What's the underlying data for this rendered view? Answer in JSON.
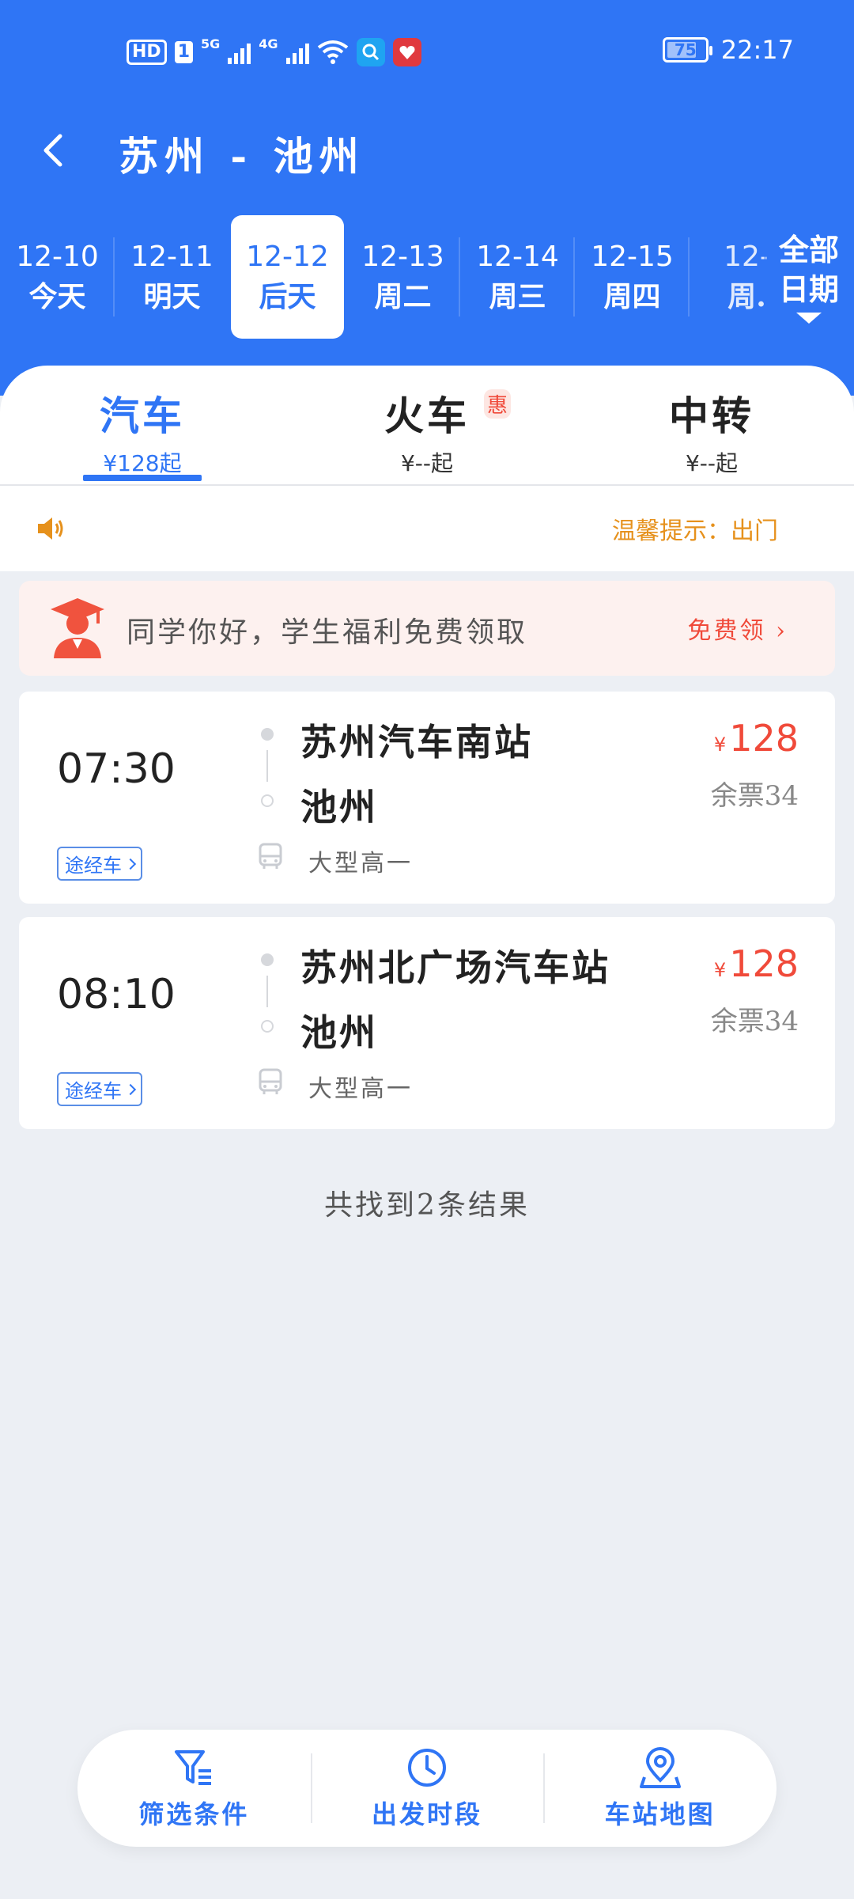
{
  "status_bar": {
    "hd": "HD",
    "sim": "1",
    "net1": "5G",
    "net2": "4G",
    "battery": "75",
    "time": "22:17"
  },
  "header": {
    "title": "苏州 - 池州"
  },
  "dates": [
    {
      "date": "12-10",
      "label": "今天"
    },
    {
      "date": "12-11",
      "label": "明天"
    },
    {
      "date": "12-12",
      "label": "后天"
    },
    {
      "date": "12-13",
      "label": "周二"
    },
    {
      "date": "12-14",
      "label": "周三"
    },
    {
      "date": "12-15",
      "label": "周四"
    },
    {
      "date": "12-",
      "label": "周."
    }
  ],
  "all_dates": {
    "line1": "全部",
    "line2": "日期"
  },
  "tabs": [
    {
      "name": "汽车",
      "price": "¥128起"
    },
    {
      "name": "火车",
      "price": "¥--起",
      "badge": "惠"
    },
    {
      "name": "中转",
      "price": "¥--起"
    }
  ],
  "notice": {
    "text": "温馨提示：出门"
  },
  "promo": {
    "text": "同学你好，学生福利免费领取",
    "button": "免费领"
  },
  "tickets": [
    {
      "time": "07:30",
      "via": "途经车",
      "from": "苏州汽车南站",
      "to": "池州",
      "bus_type": "大型高一",
      "currency": "¥",
      "price": "128",
      "remaining": "余票34"
    },
    {
      "time": "08:10",
      "via": "途经车",
      "from": "苏州北广场汽车站",
      "to": "池州",
      "bus_type": "大型高一",
      "currency": "¥",
      "price": "128",
      "remaining": "余票34"
    }
  ],
  "result_count": "共找到2条结果",
  "bottom_bar": [
    {
      "label": "筛选条件",
      "icon": "filter-icon"
    },
    {
      "label": "出发时段",
      "icon": "clock-icon"
    },
    {
      "label": "车站地图",
      "icon": "map-pin-icon"
    }
  ],
  "colors": {
    "primary": "#2f75f5",
    "price": "#f04a3a",
    "notice": "#e6911c"
  }
}
